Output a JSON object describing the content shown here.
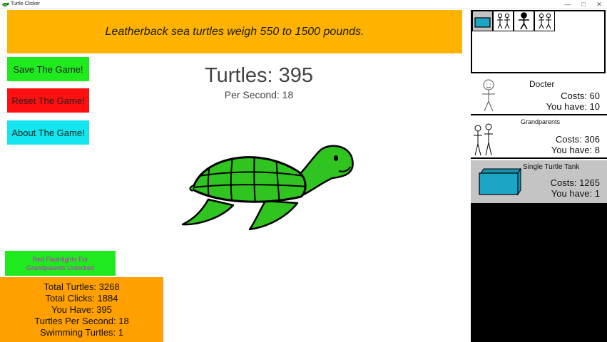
{
  "window": {
    "title": "Turtle Clicker",
    "minimize": "—",
    "maximize": "□",
    "close": "✕"
  },
  "fact": "Leatherback sea turtles weigh 550 to 1500 pounds.",
  "buttons": {
    "save": "Save The Game!",
    "reset": "Reset The Game!",
    "about": "About The Game!"
  },
  "counter": {
    "turtles_label": "Turtles: 395",
    "per_second_label": "Per Second: 18"
  },
  "notice": {
    "line1": "Red Flashlights For",
    "line2": "Grandparents Unlocked"
  },
  "stats": {
    "total_turtles": "Total Turtles: 3268",
    "total_clicks": "Total Clicks: 1884",
    "you_have": "You Have: 395",
    "turtles_per_second": "Turtles Per Second: 18",
    "swimming_turtles": "Swimming Turtles: 1"
  },
  "shop": {
    "tab_icons": [
      "turtle-tank-icon",
      "grandparents-icon",
      "docter-icon",
      "grandparents-icon"
    ],
    "items": [
      {
        "name": "Docter",
        "cost": "Costs: 60",
        "owned": "You have: 10"
      },
      {
        "name": "Grandparents",
        "cost": "Costs: 306",
        "owned": "You have: 8"
      },
      {
        "name": "Single Turtle Tank",
        "cost": "Costs: 1265",
        "owned": "You have: 1"
      }
    ]
  },
  "colors": {
    "banner": "#ffb300",
    "save": "#1eea1e",
    "reset": "#ff0f0f",
    "about": "#14e6f0",
    "notice": "#1eea1e",
    "notice_text": "#d419d4",
    "stats": "#ffa000",
    "turtle": "#2fc41f",
    "shop_selected": "#c4c4c4",
    "tank": "#1aa6c4"
  }
}
